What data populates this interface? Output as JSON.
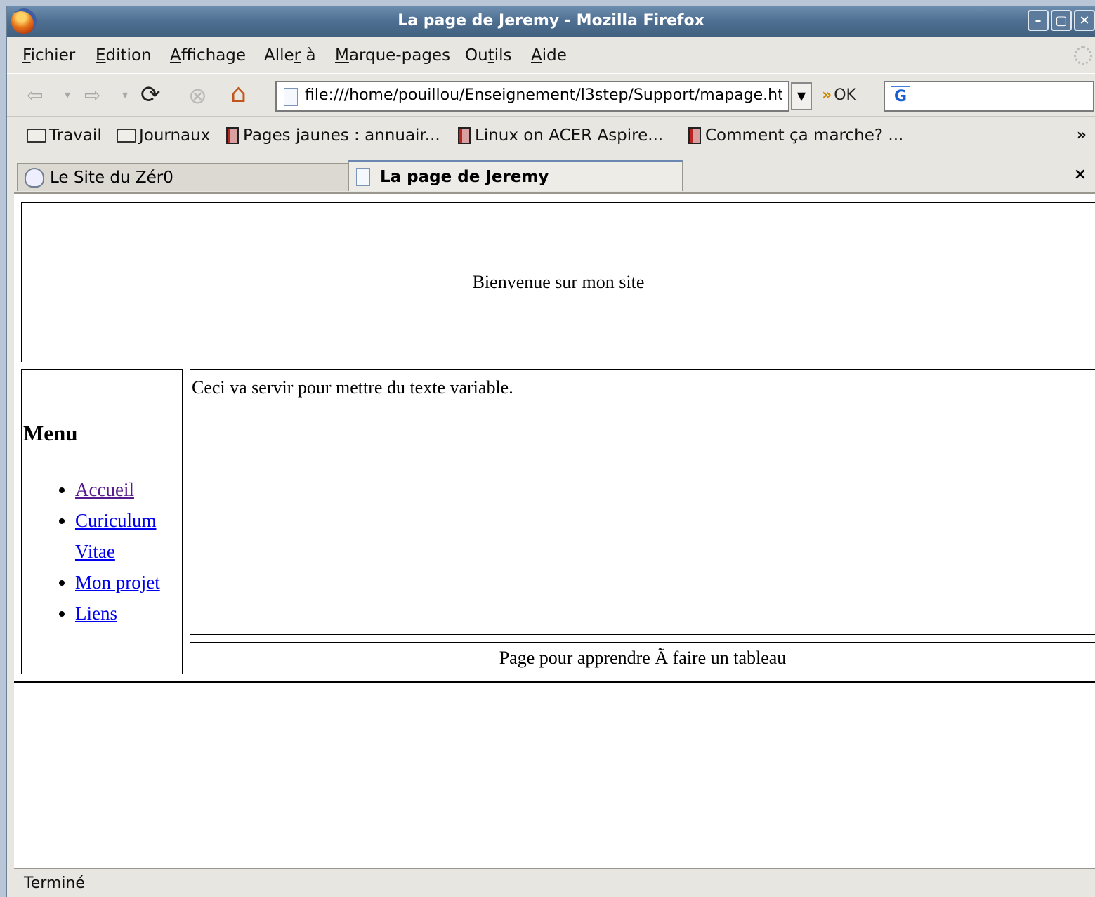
{
  "window": {
    "title": "La page de Jeremy - Mozilla Firefox",
    "controls": {
      "minimize": "–",
      "maximize": "▢",
      "close": "✕"
    }
  },
  "menubar": {
    "items": [
      {
        "key": "F",
        "rest": "ichier"
      },
      {
        "key": "E",
        "rest": "dition"
      },
      {
        "key": "A",
        "rest": "ffichage"
      },
      {
        "pre": "Alle",
        "key": "r",
        "rest": " à"
      },
      {
        "key": "M",
        "rest": "arque-pages"
      },
      {
        "pre": "Ou",
        "key": "t",
        "rest": "ils"
      },
      {
        "key": "A",
        "rest": "ide"
      }
    ]
  },
  "navbar": {
    "back_icon": "arrow-left-icon",
    "forward_icon": "arrow-right-icon",
    "reload_icon": "reload-icon",
    "stop_icon": "stop-icon",
    "home_icon": "home-icon",
    "url": "file:///home/pouillou/Enseignement/l3step/Support/mapage.ht",
    "go_label": "OK",
    "search_engine_glyph": "G"
  },
  "bookmarks": {
    "items": [
      "Travail",
      "Journaux",
      "Pages jaunes : annuair...",
      "Linux on ACER Aspire...",
      "Comment ça marche? ..."
    ],
    "overflow": "»"
  },
  "tabs": {
    "items": [
      "Le Site du Zér0",
      "La page de Jeremy"
    ],
    "active": 1,
    "close_glyph": "×"
  },
  "page": {
    "banner": "Bienvenue sur mon site",
    "menu_title": "Menu",
    "menu_links": [
      "Accueil",
      "Curiculum Vitae",
      "Mon projet",
      "Liens"
    ],
    "main_text": "Ceci va servir pour mettre du texte variable.",
    "footer": "Page pour apprendre Ã  faire un tableau"
  },
  "status": {
    "text": "Terminé"
  },
  "colors": {
    "link": "#0000ee",
    "visited_link": "#551a8b",
    "titlebar": "#4f6f92"
  }
}
